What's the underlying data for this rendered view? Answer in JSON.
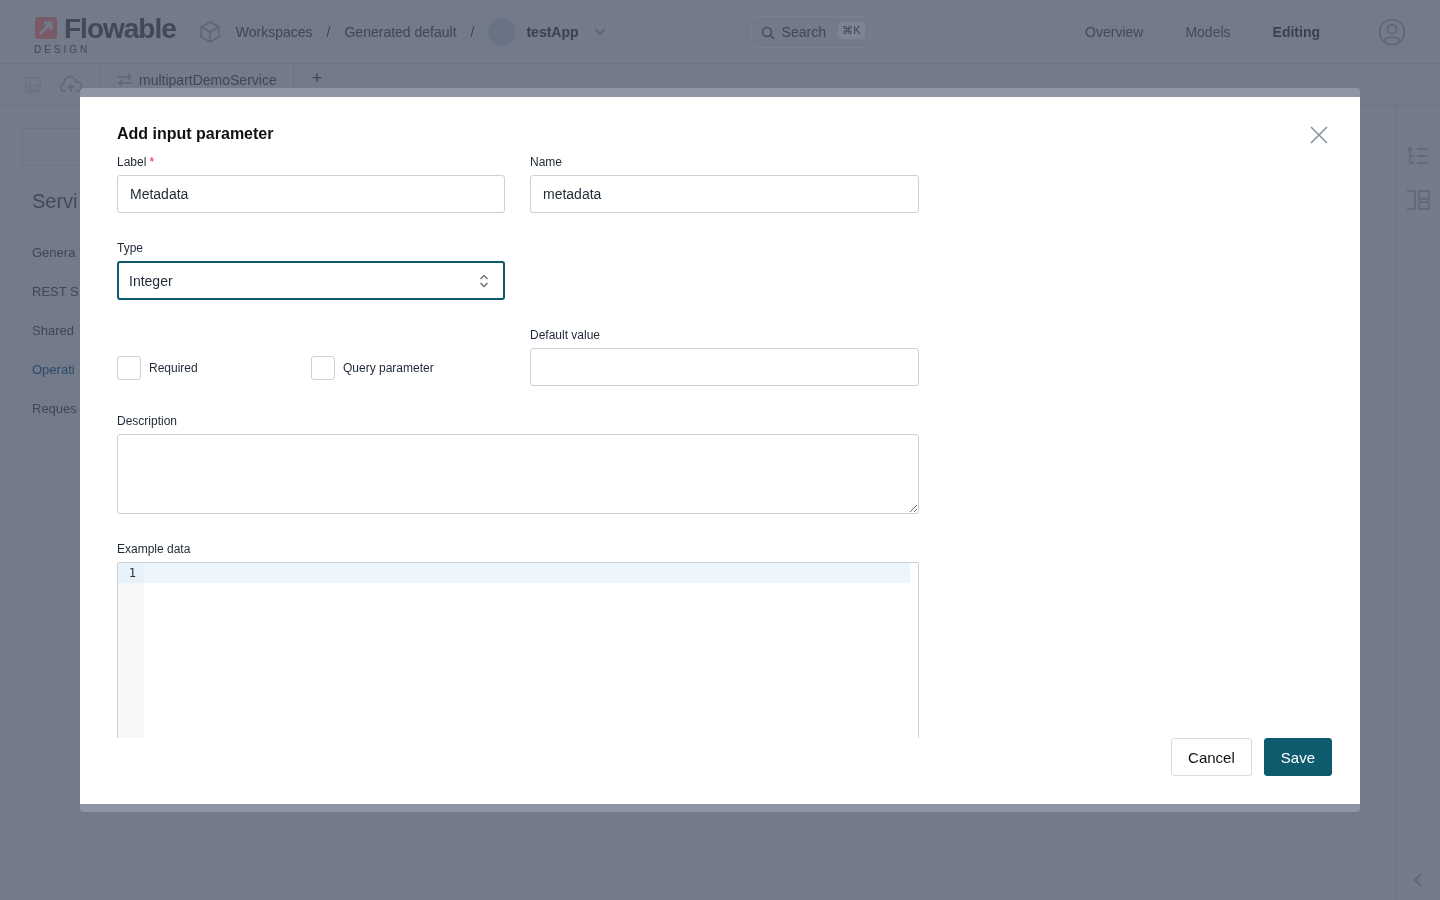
{
  "app_header": {
    "logo": "Flowable",
    "logo_sub": "DESIGN",
    "breadcrumbs": [
      "Workspaces",
      "Generated default"
    ],
    "separator": "/",
    "app": "testApp",
    "search": {
      "placeholder": "Search",
      "shortcut": "⌘K"
    },
    "nav": [
      {
        "label": "Overview",
        "selected": false
      },
      {
        "label": "Models",
        "selected": false
      },
      {
        "label": "Editing",
        "selected": true
      }
    ]
  },
  "tabs": [
    {
      "label": "multipartDemoService"
    }
  ],
  "add_tab": "+",
  "sidebar": {
    "title": "Servi",
    "items": [
      {
        "label": "Genera",
        "selected": false
      },
      {
        "label": "REST S",
        "selected": false
      },
      {
        "label": "Shared",
        "selected": false
      },
      {
        "label": "Operati",
        "selected": true
      },
      {
        "label": "Reques",
        "selected": false
      }
    ]
  },
  "dialog": {
    "title": "Add input parameter",
    "label_field": {
      "label": "Label",
      "required_mark": "*",
      "value": "Metadata"
    },
    "name_field": {
      "label": "Name",
      "value": "metadata"
    },
    "type_field": {
      "label": "Type",
      "value": "Integer",
      "focused": true
    },
    "checkboxes": [
      {
        "label": "Required",
        "checked": false
      },
      {
        "label": "Query parameter",
        "checked": false
      }
    ],
    "default_value": {
      "label": "Default value"
    },
    "description": {
      "label": "Description"
    },
    "example_data": {
      "label": "Example data",
      "line_numbers": [
        "1"
      ]
    },
    "buttons": [
      {
        "label": "Cancel",
        "kind": "secondary"
      },
      {
        "label": "Save",
        "kind": "primary"
      }
    ]
  }
}
